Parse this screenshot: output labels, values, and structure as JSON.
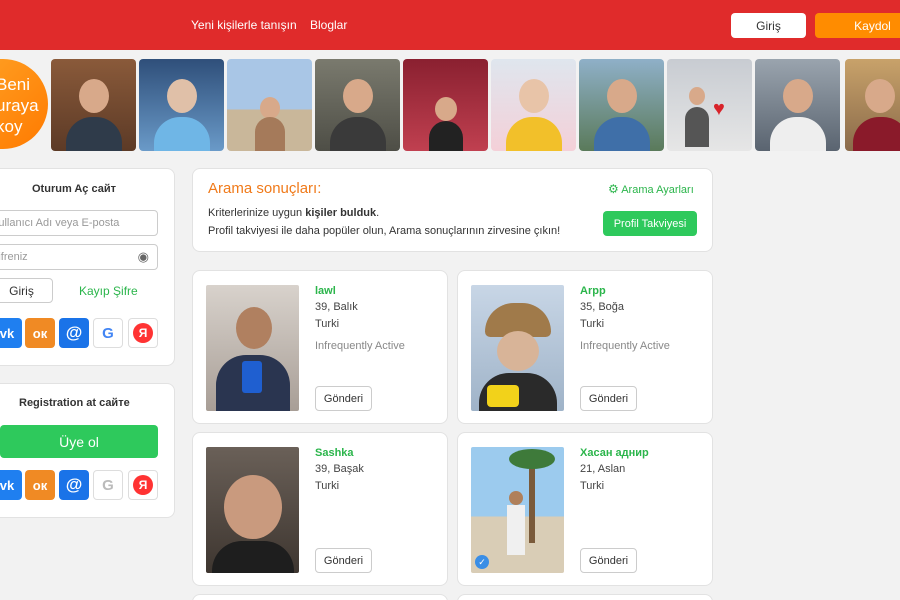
{
  "nav": {
    "links": [
      "Yeni kişilerle tanışın",
      "Bloglar"
    ],
    "login": "Giriş",
    "register": "Kaydol"
  },
  "promo": {
    "lines": [
      "Beni",
      "uraya",
      "koy"
    ]
  },
  "login_box": {
    "title": "Oturum Aç сайт",
    "username_placeholder": "Kullanıcı Adı veya E-posta",
    "password_placeholder": "Şifreniz",
    "login_button": "Giriş",
    "forgot": "Kayıp Şifre",
    "social": [
      "vk-icon",
      "odnoklassniki-icon",
      "mail-icon",
      "google-icon",
      "yandex-icon"
    ]
  },
  "registration_box": {
    "title": "Registration at сайте",
    "button": "Üye ol"
  },
  "results": {
    "title": "Arama sonuçları:",
    "settings": "Arama Ayarları",
    "line1_prefix": "Kriterlerinize uygun ",
    "line1_bold": "kişiler bulduk",
    "line1_suffix": ".",
    "line2": "Profil takviyesi ile daha popüler olun, Arama sonuçlarının zirvesine çıkın!",
    "boost_button": "Profil Takviyesi"
  },
  "profiles": [
    {
      "name": "lawl",
      "age_city": "39, Balık",
      "country": "Turki",
      "status": "Infrequently Active",
      "send": "Gönderi"
    },
    {
      "name": "Arpp",
      "age_city": "35, Boğa",
      "country": "Turki",
      "status": "Infrequently Active",
      "send": "Gönderi"
    },
    {
      "name": "Sashka",
      "age_city": "39, Başak",
      "country": "Turki",
      "status": "",
      "send": "Gönderi"
    },
    {
      "name": "Хасан аднир",
      "age_city": "21, Aslan",
      "country": "Turki",
      "status": "",
      "send": "Gönderi"
    }
  ],
  "colors": {
    "header": "#e02b2b",
    "accent_orange": "#ff8c00",
    "accent_green": "#2ec95c",
    "title_orange": "#f07a1a"
  }
}
